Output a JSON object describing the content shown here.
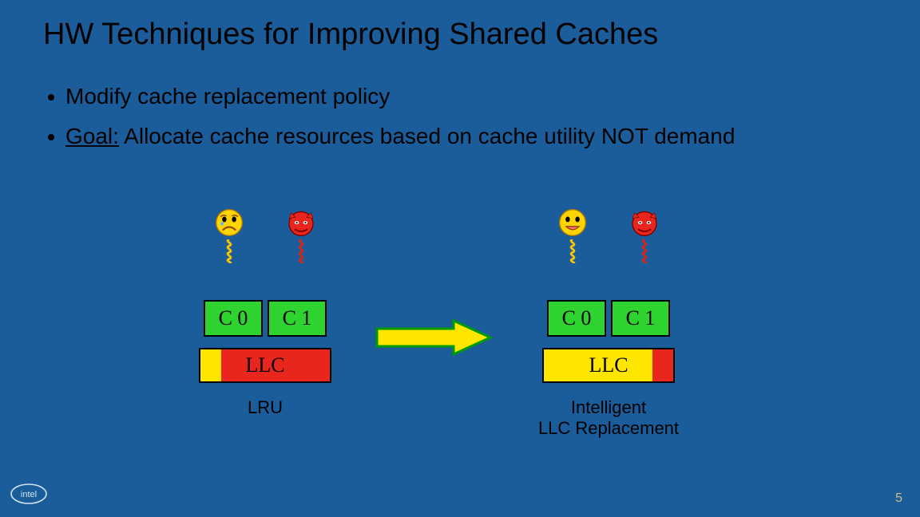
{
  "title": "HW Techniques for Improving Shared Caches",
  "bullet1": "Modify cache replacement policy",
  "bullet2_goal": "Goal:",
  "bullet2_rest": "  Allocate cache resources based on cache utility NOT demand",
  "left": {
    "core0": "C 0",
    "core1": "C 1",
    "llc": "LLC",
    "caption": "LRU",
    "seg": {
      "yellow_pct": 16,
      "red_pct": 84
    },
    "face0": "sad",
    "face1": "devil"
  },
  "right": {
    "core0": "C 0",
    "core1": "C 1",
    "llc": "LLC",
    "caption_line1": "Intelligent",
    "caption_line2": "LLC Replacement",
    "seg": {
      "yellow_pct": 84,
      "red_pct": 16
    },
    "face0": "happy",
    "face1": "devil"
  },
  "icons": {
    "arrow_fill": "#ffe600",
    "arrow_stroke": "#009b00",
    "spring_yellow": "#f7c600",
    "spring_red": "#d4261a"
  },
  "page_number": "5",
  "logo": "intel"
}
